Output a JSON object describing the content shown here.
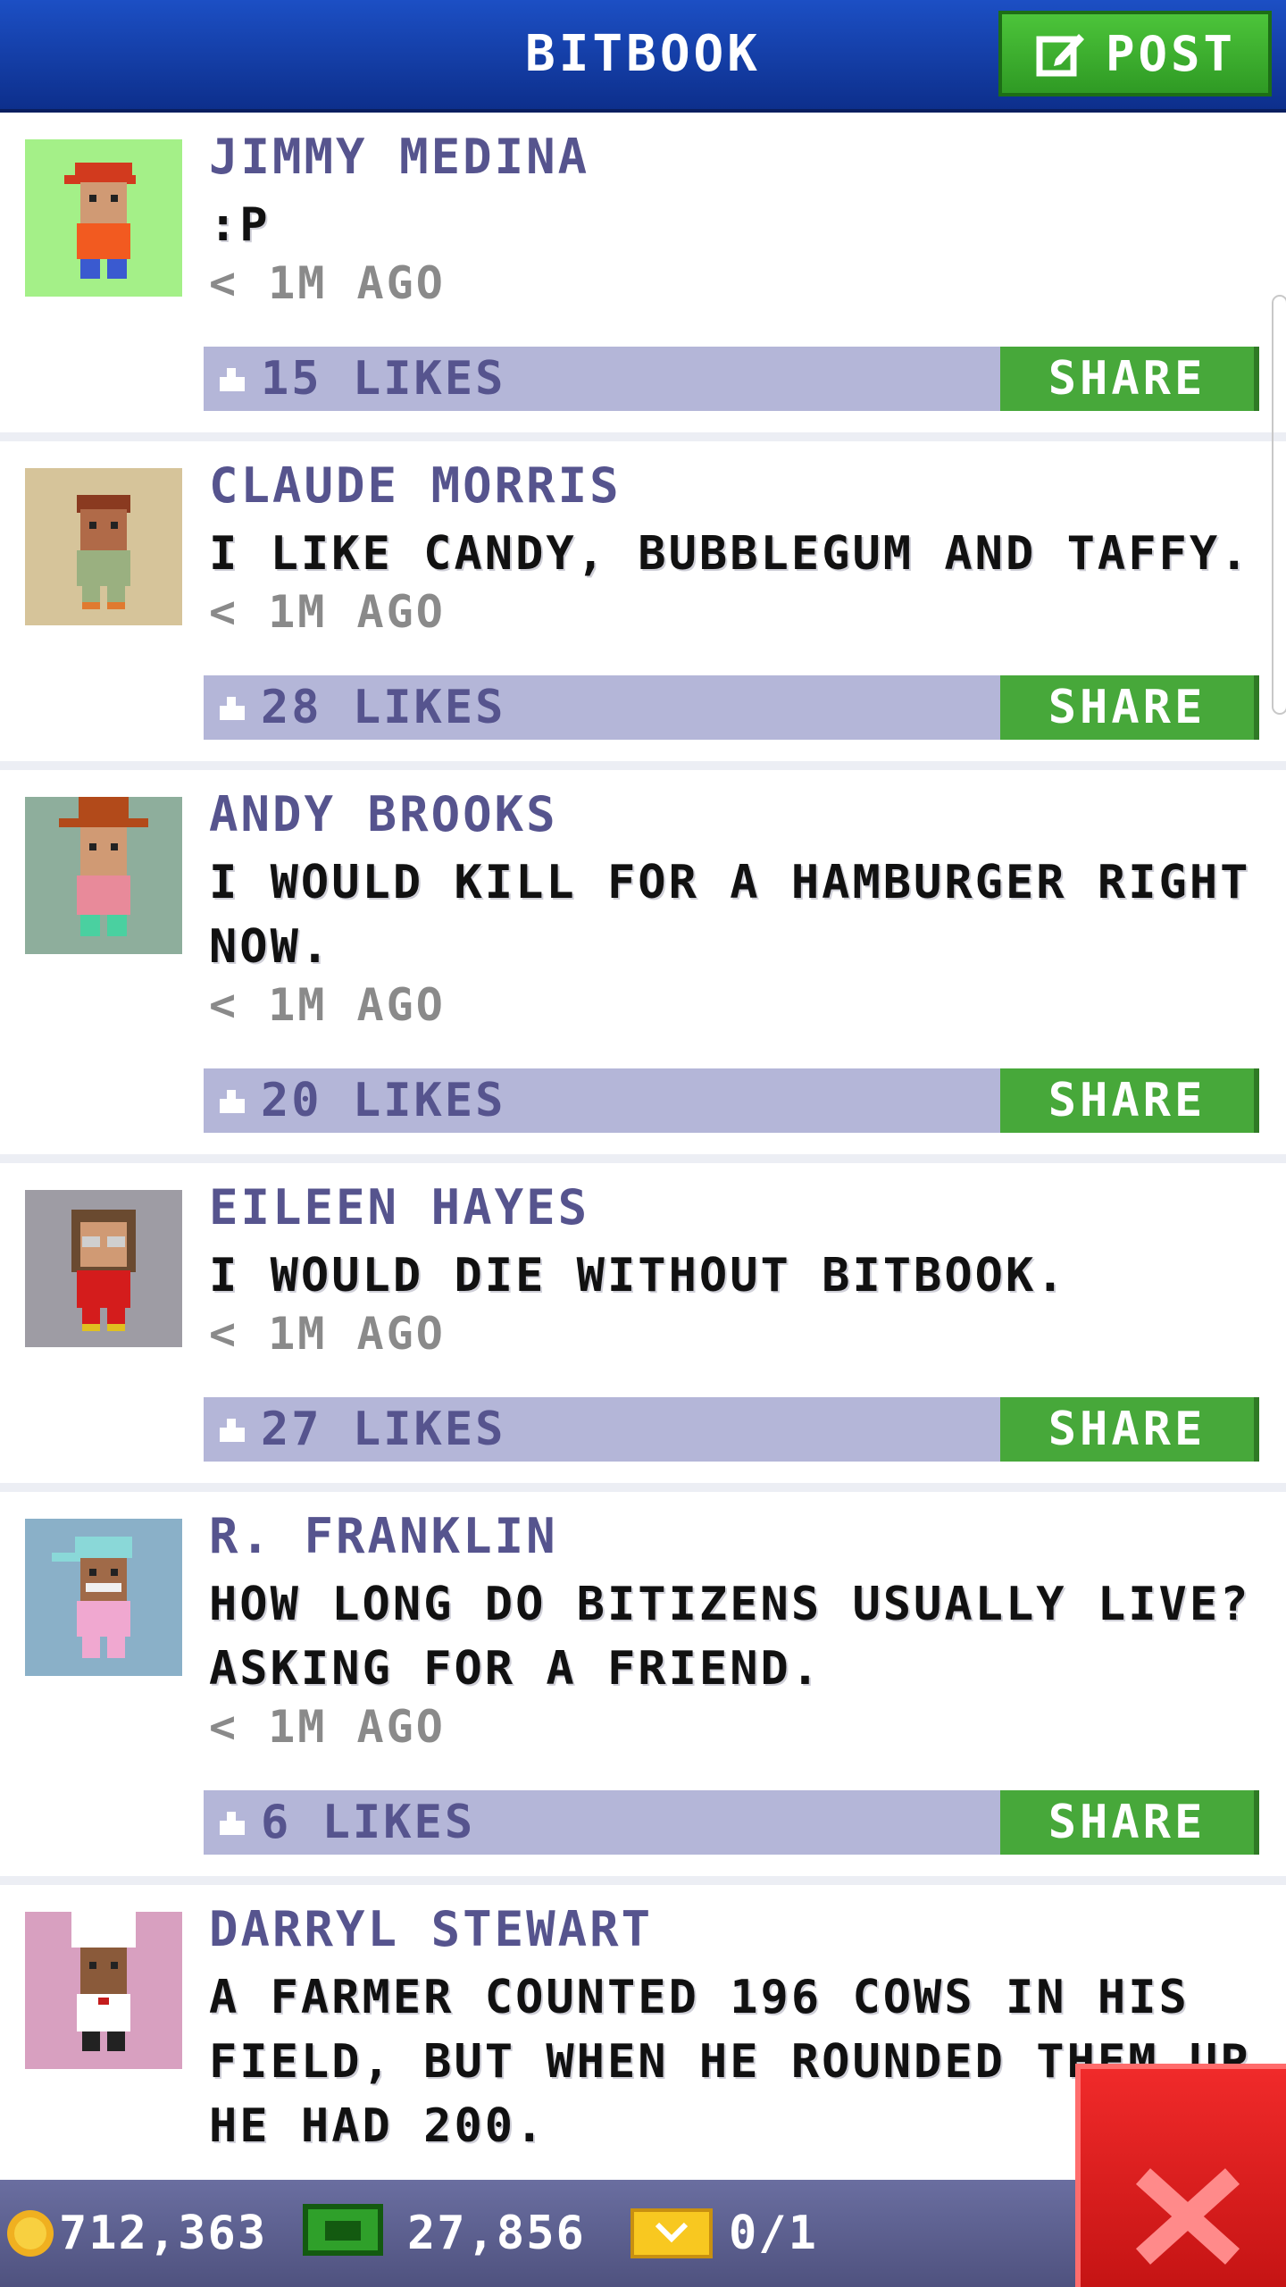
{
  "header": {
    "title": "BITBOOK",
    "post_label": "POST"
  },
  "posts": [
    {
      "author": "JIMMY MEDINA",
      "text": ":P",
      "time": "< 1M AGO",
      "likes": "15 LIKES",
      "share_label": "SHARE",
      "avatar_bg": "#a4f088",
      "hat_color": "#d23a1e",
      "shirt_color": "#f25a20",
      "pants_color": "#3a5ad0",
      "skin_color": "#d09a74"
    },
    {
      "author": "CLAUDE MORRIS",
      "text": "I LIKE CANDY, BUBBLEGUM AND TAFFY.",
      "time": "< 1M AGO",
      "likes": "28 LIKES",
      "share_label": "SHARE",
      "avatar_bg": "#d6c49a",
      "hat_color": "#8a3a20",
      "shirt_color": "#9ab080",
      "pants_color": "#9ab080",
      "skin_color": "#b06a48"
    },
    {
      "author": "ANDY BROOKS",
      "text": "I WOULD KILL FOR A HAMBURGER RIGHT NOW.",
      "time": "< 1M AGO",
      "likes": "20 LIKES",
      "share_label": "SHARE",
      "avatar_bg": "#8eae9c",
      "hat_color": "#b24a1a",
      "shirt_color": "#e88a9a",
      "pants_color": "#4ad0a0",
      "skin_color": "#d09a74"
    },
    {
      "author": "EILEEN HAYES",
      "text": "I WOULD DIE WITHOUT BITBOOK.",
      "time": "< 1M AGO",
      "likes": "27 LIKES",
      "share_label": "SHARE",
      "avatar_bg": "#9e9ca4",
      "hat_color": "#6a4a30",
      "shirt_color": "#d41c1c",
      "pants_color": "#d41c1c",
      "skin_color": "#d09a74"
    },
    {
      "author": "R. FRANKLIN",
      "text": "HOW LONG DO BITIZENS USUALLY LIVE? ASKING FOR A FRIEND.",
      "time": "< 1M AGO",
      "likes": "6 LIKES",
      "share_label": "SHARE",
      "avatar_bg": "#8ab0c8",
      "hat_color": "#8ad8d8",
      "shirt_color": "#f0a8d0",
      "pants_color": "#f0a8d0",
      "skin_color": "#a06a48"
    },
    {
      "author": "DARRYL STEWART",
      "text": "A FARMER COUNTED 196 COWS IN HIS FIELD, BUT WHEN HE ROUNDED THEM UP HE HAD 200.",
      "time": "",
      "likes": "",
      "share_label": "",
      "avatar_bg": "#d8a0c0",
      "hat_color": "#ffffff",
      "shirt_color": "#ffffff",
      "pants_color": "#222222",
      "skin_color": "#8a5a3a"
    }
  ],
  "bottom_bar": {
    "coins": "712,363",
    "bux": "27,856",
    "tickets": "0/1"
  }
}
